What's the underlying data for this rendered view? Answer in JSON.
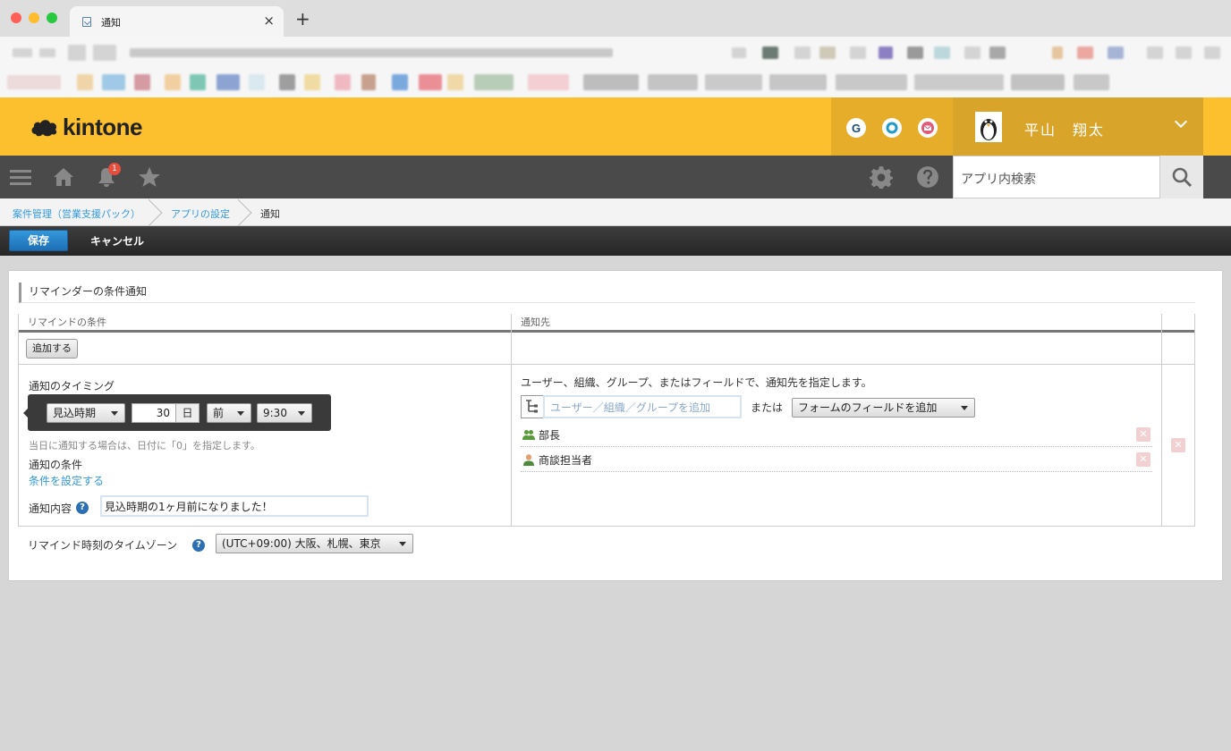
{
  "browser": {
    "tab_title": "通知",
    "tab_close": "×",
    "new_tab": "+"
  },
  "header": {
    "logo_text": "kintone",
    "icons": [
      "garoon-icon",
      "office-icon",
      "mail-icon"
    ],
    "garoon_letter": "G",
    "user_name": "平山　翔太"
  },
  "navbar": {
    "notification_count": "1",
    "search_placeholder": "アプリ内検索"
  },
  "breadcrumb": {
    "app": "案件管理（営業支援パック）",
    "settings": "アプリの設定",
    "current": "通知"
  },
  "actions": {
    "save": "保存",
    "cancel": "キャンセル"
  },
  "section": {
    "title": "リマインダーの条件通知",
    "col_condition": "リマインドの条件",
    "col_recipient": "通知先",
    "add_button": "追加する",
    "timing_label": "通知のタイミング",
    "timing": {
      "field": "見込時期",
      "days": "30",
      "unit": "日",
      "direction": "前",
      "time": "9:30"
    },
    "timing_note": "当日に通知する場合は、日付に「0」を指定します。",
    "condition_label": "通知の条件",
    "condition_link": "条件を設定する",
    "content_label": "通知内容",
    "content_value": "見込時期の1ヶ月前になりました！",
    "recipient_hint": "ユーザー、組織、グループ、またはフィールドで、通知先を指定します。",
    "recipient_placeholder": "ユーザー／組織／グループを追加",
    "or_text": "または",
    "field_select": "フォームのフィールドを追加",
    "recipients": [
      {
        "label": "部長",
        "type": "group"
      },
      {
        "label": "商談担当者",
        "type": "user"
      }
    ],
    "timezone_label": "リマインド時刻のタイムゾーン",
    "timezone_value": "(UTC+09:00) 大阪、札幌、東京"
  },
  "colors": {
    "header_yellow": "#fcbf2e",
    "nav_dark": "#4a4a4a",
    "link_blue": "#3498db",
    "save_blue": "#1e6fb5"
  }
}
